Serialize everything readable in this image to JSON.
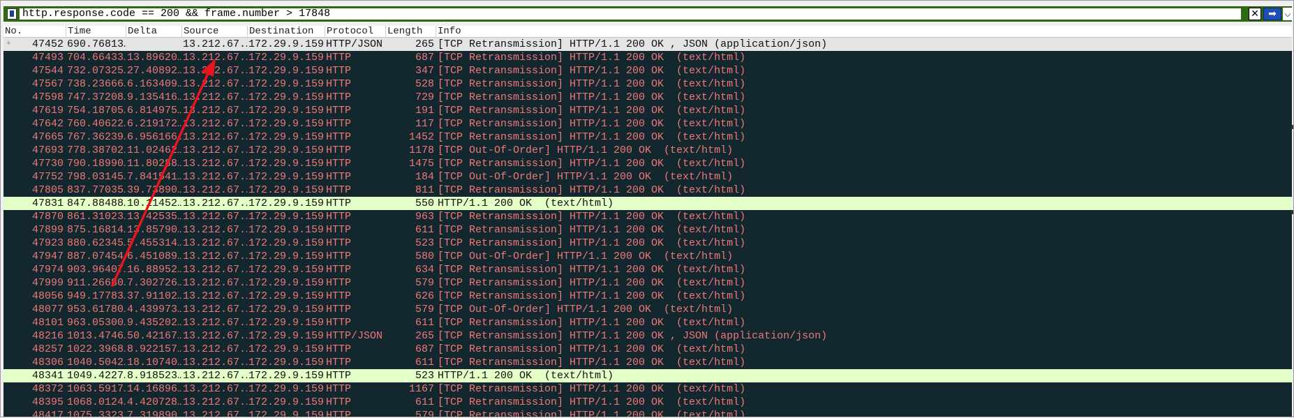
{
  "filter": {
    "expression": "http.response.code == 200 && frame.number > 17848",
    "clear_icon": "close-icon",
    "apply_icon": "arrow-right-icon",
    "dropdown_icon": "chevron-down-icon",
    "clear_glyph": "✕",
    "apply_glyph": "➡",
    "dropdown_glyph": "⌵"
  },
  "columns": {
    "no": "No.",
    "time": "Time",
    "delta": "Delta",
    "source": "Source",
    "destination": "Destination",
    "protocol": "Protocol",
    "length": "Length",
    "info": "Info"
  },
  "colors": {
    "list_background": "#12272e",
    "retransmission_text": "#f07878",
    "ok_row_background": "#e4ffc7",
    "selected_row_background": "#e4e4e4",
    "filter_valid": "#2f6b0f",
    "annotation_arrow": "#e8141e"
  },
  "rows": [
    {
      "no": "47452",
      "time": "690.76813…",
      "delta": "",
      "source": "13.212.67.…",
      "destination": "172.29.9.159",
      "protocol": "HTTP/JSON",
      "length": "265",
      "info": "[TCP Retransmission] HTTP/1.1 200 OK , JSON (application/json)",
      "style": "sel"
    },
    {
      "no": "47493",
      "time": "704.66433…",
      "delta": "13.89620…",
      "source": "13.212.67.…",
      "destination": "172.29.9.159",
      "protocol": "HTTP",
      "length": "687",
      "info": "[TCP Retransmission] HTTP/1.1 200 OK  (text/html)",
      "style": "bad"
    },
    {
      "no": "47544",
      "time": "732.07325…",
      "delta": "27.40892…",
      "source": "13.212.67.…",
      "destination": "172.29.9.159",
      "protocol": "HTTP",
      "length": "347",
      "info": "[TCP Retransmission] HTTP/1.1 200 OK  (text/html)",
      "style": "bad"
    },
    {
      "no": "47567",
      "time": "738.23666…",
      "delta": "6.163409…",
      "source": "13.212.67.…",
      "destination": "172.29.9.159",
      "protocol": "HTTP",
      "length": "528",
      "info": "[TCP Retransmission] HTTP/1.1 200 OK  (text/html)",
      "style": "bad"
    },
    {
      "no": "47598",
      "time": "747.37208…",
      "delta": "9.135416…",
      "source": "13.212.67.…",
      "destination": "172.29.9.159",
      "protocol": "HTTP",
      "length": "729",
      "info": "[TCP Retransmission] HTTP/1.1 200 OK  (text/html)",
      "style": "bad"
    },
    {
      "no": "47619",
      "time": "754.18705…",
      "delta": "6.814975…",
      "source": "13.212.67.…",
      "destination": "172.29.9.159",
      "protocol": "HTTP",
      "length": "191",
      "info": "[TCP Retransmission] HTTP/1.1 200 OK  (text/html)",
      "style": "bad"
    },
    {
      "no": "47642",
      "time": "760.40622…",
      "delta": "6.219172…",
      "source": "13.212.67.…",
      "destination": "172.29.9.159",
      "protocol": "HTTP",
      "length": "117",
      "info": "[TCP Retransmission] HTTP/1.1 200 OK  (text/html)",
      "style": "bad"
    },
    {
      "no": "47665",
      "time": "767.36239…",
      "delta": "6.956166…",
      "source": "13.212.67.…",
      "destination": "172.29.9.159",
      "protocol": "HTTP",
      "length": "1452",
      "info": "[TCP Retransmission] HTTP/1.1 200 OK  (text/html)",
      "style": "bad"
    },
    {
      "no": "47693",
      "time": "778.38702…",
      "delta": "11.02462…",
      "source": "13.212.67.…",
      "destination": "172.29.9.159",
      "protocol": "HTTP",
      "length": "1178",
      "info": "[TCP Out-Of-Order] HTTP/1.1 200 OK  (text/html)",
      "style": "bad"
    },
    {
      "no": "47730",
      "time": "790.18990…",
      "delta": "11.80288…",
      "source": "13.212.67.…",
      "destination": "172.29.9.159",
      "protocol": "HTTP",
      "length": "1475",
      "info": "[TCP Retransmission] HTTP/1.1 200 OK  (text/html)",
      "style": "bad"
    },
    {
      "no": "47752",
      "time": "798.03145…",
      "delta": "7.841541…",
      "source": "13.212.67.…",
      "destination": "172.29.9.159",
      "protocol": "HTTP",
      "length": "184",
      "info": "[TCP Out-Of-Order] HTTP/1.1 200 OK  (text/html)",
      "style": "bad"
    },
    {
      "no": "47805",
      "time": "837.77035…",
      "delta": "39.73890…",
      "source": "13.212.67.…",
      "destination": "172.29.9.159",
      "protocol": "HTTP",
      "length": "811",
      "info": "[TCP Retransmission] HTTP/1.1 200 OK  (text/html)",
      "style": "bad"
    },
    {
      "no": "47831",
      "time": "847.88488…",
      "delta": "10.11452…",
      "source": "13.212.67.…",
      "destination": "172.29.9.159",
      "protocol": "HTTP",
      "length": "550",
      "info": "HTTP/1.1 200 OK  (text/html)",
      "style": "ok"
    },
    {
      "no": "47870",
      "time": "861.31023…",
      "delta": "13.42535…",
      "source": "13.212.67.…",
      "destination": "172.29.9.159",
      "protocol": "HTTP",
      "length": "963",
      "info": "[TCP Retransmission] HTTP/1.1 200 OK  (text/html)",
      "style": "bad"
    },
    {
      "no": "47899",
      "time": "875.16814…",
      "delta": "13.85790…",
      "source": "13.212.67.…",
      "destination": "172.29.9.159",
      "protocol": "HTTP",
      "length": "611",
      "info": "[TCP Retransmission] HTTP/1.1 200 OK  (text/html)",
      "style": "bad"
    },
    {
      "no": "47923",
      "time": "880.62345…",
      "delta": "5.455314…",
      "source": "13.212.67.…",
      "destination": "172.29.9.159",
      "protocol": "HTTP",
      "length": "523",
      "info": "[TCP Retransmission] HTTP/1.1 200 OK  (text/html)",
      "style": "bad"
    },
    {
      "no": "47947",
      "time": "887.07454…",
      "delta": "6.451089…",
      "source": "13.212.67.…",
      "destination": "172.29.9.159",
      "protocol": "HTTP",
      "length": "580",
      "info": "[TCP Out-Of-Order] HTTP/1.1 200 OK  (text/html)",
      "style": "bad"
    },
    {
      "no": "47974",
      "time": "903.96407…",
      "delta": "16.88952…",
      "source": "13.212.67.…",
      "destination": "172.29.9.159",
      "protocol": "HTTP",
      "length": "634",
      "info": "[TCP Retransmission] HTTP/1.1 200 OK  (text/html)",
      "style": "bad"
    },
    {
      "no": "47999",
      "time": "911.26680…",
      "delta": "7.302726…",
      "source": "13.212.67.…",
      "destination": "172.29.9.159",
      "protocol": "HTTP",
      "length": "579",
      "info": "[TCP Retransmission] HTTP/1.1 200 OK  (text/html)",
      "style": "bad"
    },
    {
      "no": "48056",
      "time": "949.17783…",
      "delta": "37.91102…",
      "source": "13.212.67.…",
      "destination": "172.29.9.159",
      "protocol": "HTTP",
      "length": "626",
      "info": "[TCP Retransmission] HTTP/1.1 200 OK  (text/html)",
      "style": "bad"
    },
    {
      "no": "48077",
      "time": "953.61780…",
      "delta": "4.439973…",
      "source": "13.212.67.…",
      "destination": "172.29.9.159",
      "protocol": "HTTP",
      "length": "579",
      "info": "[TCP Out-Of-Order] HTTP/1.1 200 OK  (text/html)",
      "style": "bad"
    },
    {
      "no": "48101",
      "time": "963.05300…",
      "delta": "9.435202…",
      "source": "13.212.67.…",
      "destination": "172.29.9.159",
      "protocol": "HTTP",
      "length": "611",
      "info": "[TCP Retransmission] HTTP/1.1 200 OK  (text/html)",
      "style": "bad"
    },
    {
      "no": "48216",
      "time": "1013.4746…",
      "delta": "50.42167…",
      "source": "13.212.67.…",
      "destination": "172.29.9.159",
      "protocol": "HTTP/JSON",
      "length": "265",
      "info": "[TCP Retransmission] HTTP/1.1 200 OK , JSON (application/json)",
      "style": "bad"
    },
    {
      "no": "48257",
      "time": "1022.3968…",
      "delta": "8.922157…",
      "source": "13.212.67.…",
      "destination": "172.29.9.159",
      "protocol": "HTTP",
      "length": "687",
      "info": "[TCP Retransmission] HTTP/1.1 200 OK  (text/html)",
      "style": "bad"
    },
    {
      "no": "48306",
      "time": "1040.5042…",
      "delta": "18.10740…",
      "source": "13.212.67.…",
      "destination": "172.29.9.159",
      "protocol": "HTTP",
      "length": "611",
      "info": "[TCP Retransmission] HTTP/1.1 200 OK  (text/html)",
      "style": "bad"
    },
    {
      "no": "48341",
      "time": "1049.4227…",
      "delta": "8.918523…",
      "source": "13.212.67.…",
      "destination": "172.29.9.159",
      "protocol": "HTTP",
      "length": "523",
      "info": "HTTP/1.1 200 OK  (text/html)",
      "style": "ok"
    },
    {
      "no": "48372",
      "time": "1063.5917…",
      "delta": "14.16896…",
      "source": "13.212.67.…",
      "destination": "172.29.9.159",
      "protocol": "HTTP",
      "length": "1167",
      "info": "[TCP Retransmission] HTTP/1.1 200 OK  (text/html)",
      "style": "bad"
    },
    {
      "no": "48395",
      "time": "1068.0124…",
      "delta": "4.420728…",
      "source": "13.212.67.…",
      "destination": "172.29.9.159",
      "protocol": "HTTP",
      "length": "611",
      "info": "[TCP Retransmission] HTTP/1.1 200 OK  (text/html)",
      "style": "bad"
    },
    {
      "no": "48417",
      "time": "1075.3323…",
      "delta": "7.319890…",
      "source": "13.212.67.…",
      "destination": "172.29.9.159",
      "protocol": "HTTP",
      "length": "579",
      "info": "[TCP Retransmission] HTTP/1.1 200 OK  (text/html)",
      "style": "bad"
    }
  ]
}
